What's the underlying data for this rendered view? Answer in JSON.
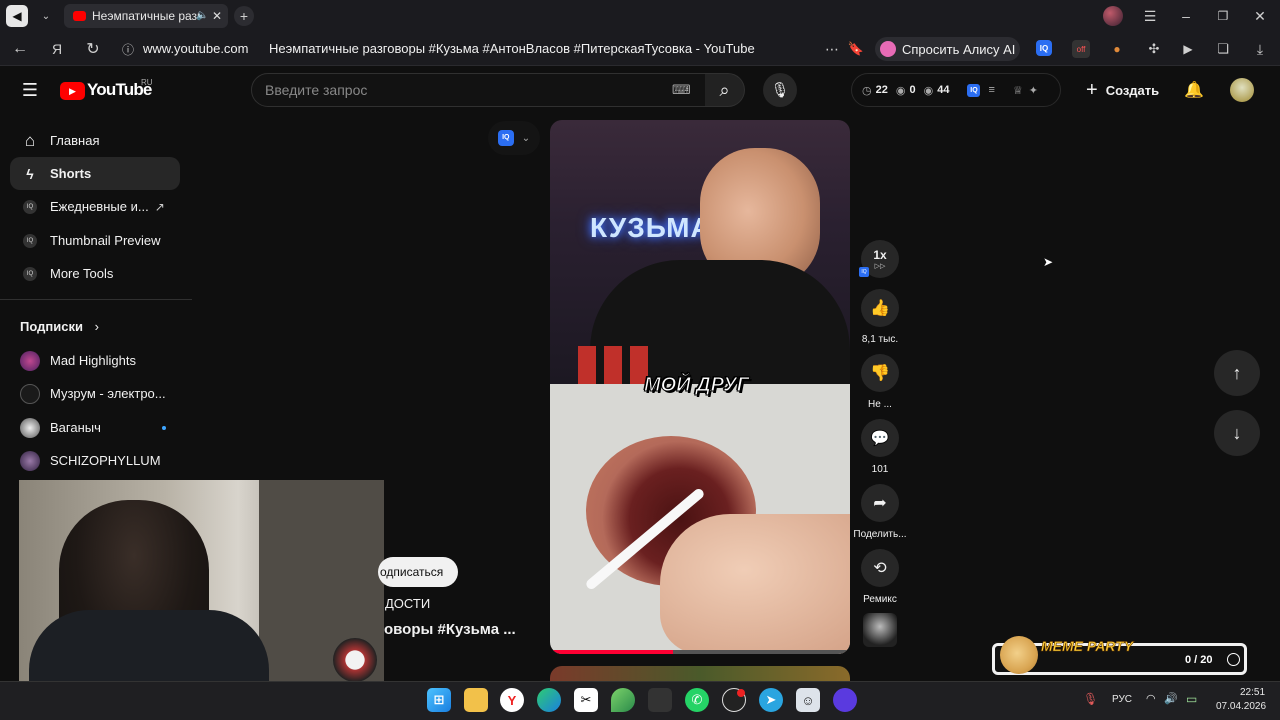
{
  "browser": {
    "tab_title": "Неэмпатичные разг",
    "url_domain": "www.youtube.com",
    "page_title": "Неэмпатичные разговоры #Кузьма #АнтонВласов #ПитерскаяТусовка - YouTube",
    "alice_button": "Спросить Алису AI"
  },
  "youtube": {
    "logo_text": "YouTube",
    "logo_region": "RU",
    "search_placeholder": "Введите запрос",
    "stats": {
      "watch": "22",
      "eye_a": "0",
      "eye_b": "44"
    },
    "create_label": "Создать"
  },
  "sidebar": {
    "items": [
      {
        "label": "Главная"
      },
      {
        "label": "Shorts"
      },
      {
        "label": "Ежедневные и..."
      },
      {
        "label": "Thumbnail Preview"
      },
      {
        "label": "More Tools"
      }
    ],
    "subscriptions_title": "Подписки",
    "subscriptions": [
      {
        "label": "Mad Highlights"
      },
      {
        "label": "Музрум - электро..."
      },
      {
        "label": "Ваганыч"
      },
      {
        "label": "SCHIZOPHYLLUM"
      }
    ]
  },
  "shorts": {
    "video_sign": "КУЗЬМА",
    "caption": "МОЙ ДРУГ",
    "speed": "1x",
    "subscribe_label": "одписаться",
    "channel_fragment": "ДОСТИ",
    "title_fragment": "оворы #Кузьма ...",
    "actions": {
      "likes": "8,1 тыс.",
      "dislike": "Не ...",
      "comments": "101",
      "share": "Поделить...",
      "remix": "Ремикс"
    }
  },
  "overlay": {
    "meme_party_title": "MEME PARTY",
    "meme_party_count": "0 / 20"
  },
  "taskbar": {
    "lang": "РУС",
    "time": "22:51",
    "date": "07.04.2026"
  },
  "colors": {
    "youtube_red": "#ff0000",
    "background": "#0f0f0f",
    "chip": "#272727",
    "alice_pink": "#e86bb6",
    "progress_red": "#ff0033"
  }
}
